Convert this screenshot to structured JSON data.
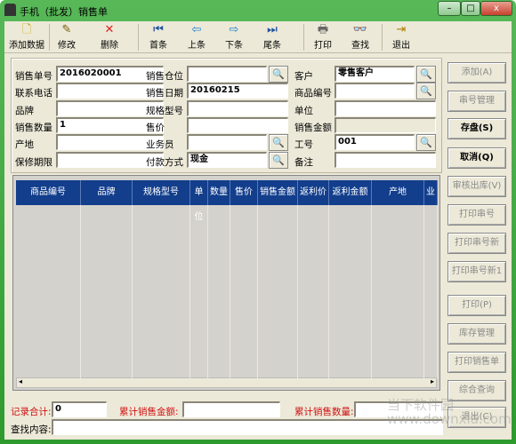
{
  "window": {
    "title": "手机（批发）销售单",
    "min": "–",
    "max": "□",
    "close": "x"
  },
  "toolbar": [
    {
      "label": "添加数据",
      "icon": "new-document-icon",
      "glyph": "🗋",
      "color": "#c8a000"
    },
    {
      "label": "修改",
      "icon": "edit-icon",
      "glyph": "✎",
      "color": "#7a5a00"
    },
    {
      "label": "删除",
      "icon": "delete-icon",
      "glyph": "✕",
      "color": "#e02020"
    },
    {
      "label": "首条",
      "icon": "first-record-icon",
      "glyph": "⏮",
      "color": "#2050a0"
    },
    {
      "label": "上条",
      "icon": "previous-record-icon",
      "glyph": "⇦",
      "color": "#2080d0"
    },
    {
      "label": "下条",
      "icon": "next-record-icon",
      "glyph": "⇨",
      "color": "#2080d0"
    },
    {
      "label": "尾条",
      "icon": "last-record-icon",
      "glyph": "⏭",
      "color": "#2050a0"
    },
    {
      "label": "打印",
      "icon": "printer-icon",
      "glyph": "🖶",
      "color": "#666666"
    },
    {
      "label": "查找",
      "icon": "binoculars-icon",
      "glyph": "👓",
      "color": "#333333"
    },
    {
      "label": "退出",
      "icon": "exit-door-icon",
      "glyph": "⇥",
      "color": "#b08000"
    }
  ],
  "form": [
    [
      {
        "label": "销售单号",
        "value": "2016020001"
      },
      {
        "label": "销售仓位",
        "value": "",
        "lookup": true
      },
      {
        "label": "客户",
        "value": "零售客户",
        "lookup": true
      }
    ],
    [
      {
        "label": "联系电话",
        "value": ""
      },
      {
        "label": "销售日期",
        "value": "20160215"
      },
      {
        "label": "商品编号",
        "value": "",
        "lookup": true
      }
    ],
    [
      {
        "label": "品牌",
        "value": ""
      },
      {
        "label": "规格型号",
        "value": ""
      },
      {
        "label": "单位",
        "value": ""
      }
    ],
    [
      {
        "label": "销售数量",
        "value": "1"
      },
      {
        "label": "售价",
        "value": ""
      },
      {
        "label": "销售金额",
        "value": "",
        "disabled": true
      }
    ],
    [
      {
        "label": "产地",
        "value": ""
      },
      {
        "label": "业务员",
        "value": "",
        "lookup": true
      },
      {
        "label": "工号",
        "value": "001",
        "lookup": true
      }
    ],
    [
      {
        "label": "保修期限",
        "value": ""
      },
      {
        "label": "付款方式",
        "value": "现金",
        "lookup": true
      },
      {
        "label": "备注",
        "value": ""
      }
    ]
  ],
  "grid": {
    "columns": [
      "商品编号",
      "品牌",
      "规格型号",
      "单位",
      "数量",
      "售价",
      "销售金额",
      "返利价",
      "返利金额",
      "产地",
      "业"
    ]
  },
  "side_buttons": [
    {
      "label": "添加(A)",
      "enabled": false
    },
    {
      "label": "串号管理",
      "enabled": false
    },
    {
      "label": "存盘(S)",
      "enabled": true
    },
    {
      "label": "取消(Q)",
      "enabled": true
    },
    {
      "label": "审核出库(V)",
      "enabled": false
    },
    {
      "label": "打印串号",
      "enabled": false
    },
    {
      "label": "打印串号新",
      "enabled": false
    },
    {
      "label": "打印串号新1",
      "enabled": false
    },
    {
      "label": "打印(P)",
      "enabled": false
    },
    {
      "label": "库存管理",
      "enabled": false
    },
    {
      "label": "打印销售单",
      "enabled": false
    },
    {
      "label": "综合查询",
      "enabled": false
    },
    {
      "label": "退出(C)",
      "enabled": false
    }
  ],
  "footer": {
    "record_total_label": "记录合计:",
    "record_total": "0",
    "sum_amount_label": "累计销售金额:",
    "sum_amount": "",
    "sum_qty_label": "累计销售数量:",
    "sum_qty": "",
    "search_label": "查找内容:",
    "search_value": ""
  },
  "watermark": "当下软件园 www.downxia.com"
}
